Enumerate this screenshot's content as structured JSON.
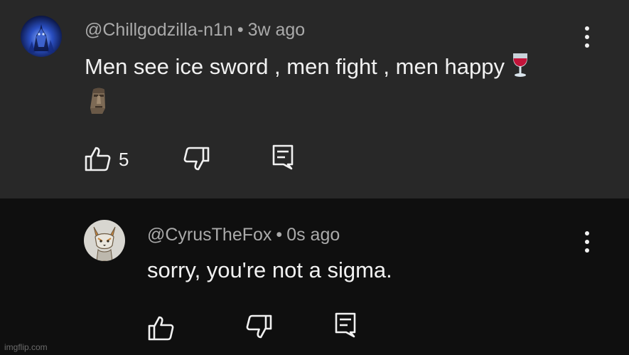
{
  "comments": {
    "primary": {
      "author": "@Chillgodzilla-n1n",
      "separator": "•",
      "time": "3w ago",
      "text": "Men see ice sword , men fight , men happy",
      "emoji_names": [
        "wine-glass-icon",
        "moai-icon"
      ],
      "like_count": "5"
    },
    "reply": {
      "author": "@CyrusTheFox",
      "separator": "•",
      "time": "0s ago",
      "text": "sorry, you're not a sigma."
    }
  },
  "watermark": "imgflip.com",
  "icons": {
    "like": "thumbs-up-icon",
    "dislike": "thumbs-down-icon",
    "reply": "reply-icon",
    "menu": "more-vert-icon"
  },
  "colors": {
    "primary_bg": "#282828",
    "reply_bg": "#0f0f0f",
    "text": "#f1f1f1",
    "meta": "#aaaaaa"
  }
}
